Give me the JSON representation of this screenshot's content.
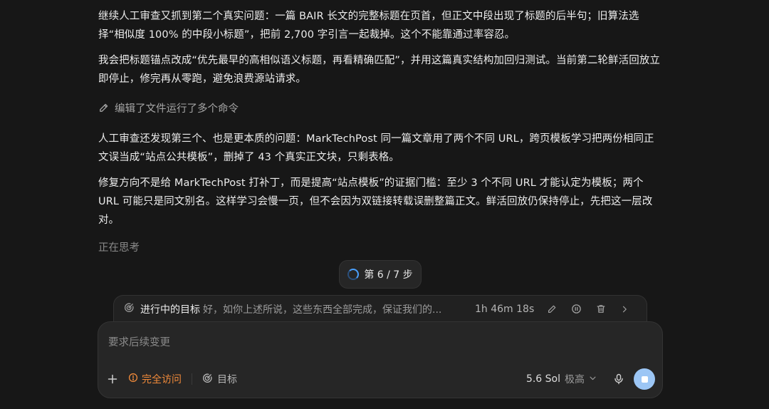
{
  "messages": {
    "p1": "继续人工审查又抓到第二个真实问题：一篇 BAIR 长文的完整标题在页首，但正文中段出现了标题的后半句；旧算法选择“相似度 100% 的中段小标题”，把前 2,700 字引言一起裁掉。这个不能靠通过率容忍。",
    "p2": "我会把标题锚点改成“优先最早的高相似语义标题，再看精确匹配”，并用这篇真实结构加回归测试。当前第二轮鲜活回放立即停止，修完再从零跑，避免浪费源站请求。",
    "tool_summary": "编辑了文件运行了多个命令",
    "p3": "人工审查还发现第三个、也是更本质的问题：MarkTechPost 同一篇文章用了两个不同 URL，跨页模板学习把两份相同正文误当成“站点公共模板”，删掉了 43 个真实正文块，只剩表格。",
    "p4": "修复方向不是给 MarkTechPost 打补丁，而是提高“站点模板”的证据门槛：至少 3 个不同 URL 才能认定为模板；两个 URL 可能只是同文别名。这样学习会慢一页，但不会因为双链接转载误删整篇正文。鲜活回放仍保持停止，先把这一层改对。",
    "thinking": "正在思考"
  },
  "progress": {
    "step_label": "第 6 / 7 步"
  },
  "goal": {
    "title": "进行中的目标",
    "text": "好，如你上述所说，这些东西全部完成，保证我们的...",
    "elapsed": "1h 46m 18s"
  },
  "composer": {
    "placeholder": "要求后续变更",
    "access_label": "完全访问",
    "target_label": "目标",
    "model": "5.6 Sol",
    "effort": "极高"
  },
  "colors": {
    "background": "#171717",
    "access_orange": "#f08a3a",
    "stop_blue": "#9cc6f5",
    "spinner_blue": "#4aa0ff"
  }
}
